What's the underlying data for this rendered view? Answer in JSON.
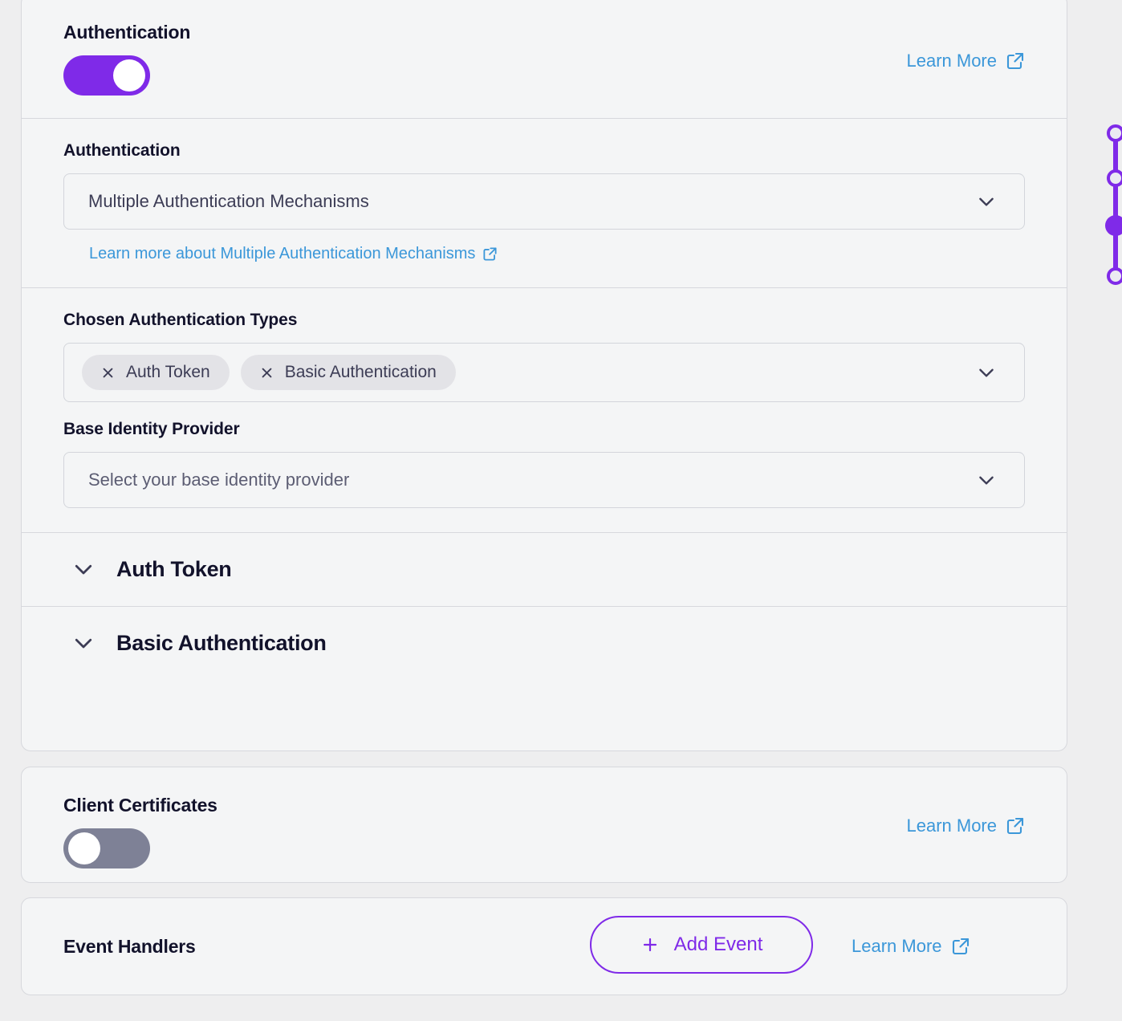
{
  "authentication_card": {
    "header": {
      "title": "Authentication",
      "toggle_state": "on",
      "toggle_name": "authentication-toggle",
      "learn_more_label": "Learn More",
      "learn_more_icon": "external-link-icon"
    },
    "auth_mechanism": {
      "label": "Authentication",
      "selected_value": "Multiple Authentication Mechanisms",
      "chevron_icon": "chevron-down-icon",
      "sub_link_label": "Learn more about Multiple Authentication Mechanisms",
      "sub_link_icon": "external-link-icon"
    },
    "chosen_types": {
      "label": "Chosen Authentication Types",
      "chips": [
        {
          "label": "Auth Token",
          "remove_icon": "close-icon"
        },
        {
          "label": "Basic Authentication",
          "remove_icon": "close-icon"
        }
      ],
      "chevron_icon": "chevron-down-icon"
    },
    "base_identity_provider": {
      "label": "Base Identity Provider",
      "placeholder": "Select your base identity provider",
      "value": "",
      "chevron_icon": "chevron-down-icon"
    },
    "accordions": [
      {
        "title": "Auth Token",
        "chevron_icon": "chevron-down-icon",
        "expanded": false
      },
      {
        "title": "Basic Authentication",
        "chevron_icon": "chevron-down-icon",
        "expanded": false
      }
    ]
  },
  "client_certificates_card": {
    "title": "Client Certificates",
    "toggle_state": "off",
    "learn_more_label": "Learn More",
    "learn_more_icon": "external-link-icon"
  },
  "event_handlers_card": {
    "title": "Event Handlers",
    "add_event_label": "Add Event",
    "add_event_icon": "plus-icon",
    "learn_more_label": "Learn More",
    "learn_more_icon": "external-link-icon"
  },
  "stepper": {
    "name": "progress-stepper",
    "nodes": [
      {
        "state": "pending"
      },
      {
        "state": "pending"
      },
      {
        "state": "active"
      },
      {
        "state": "pending"
      }
    ]
  },
  "colors": {
    "accent_purple": "#7f2ae8",
    "link_blue": "#3b97d9",
    "toggle_off_gray": "#7e8196",
    "text_dark": "#12122b",
    "page_bg": "#eeeeef",
    "card_bg": "#f4f5f6",
    "border": "#d7d8dd",
    "chip_bg": "#e3e3e7"
  }
}
